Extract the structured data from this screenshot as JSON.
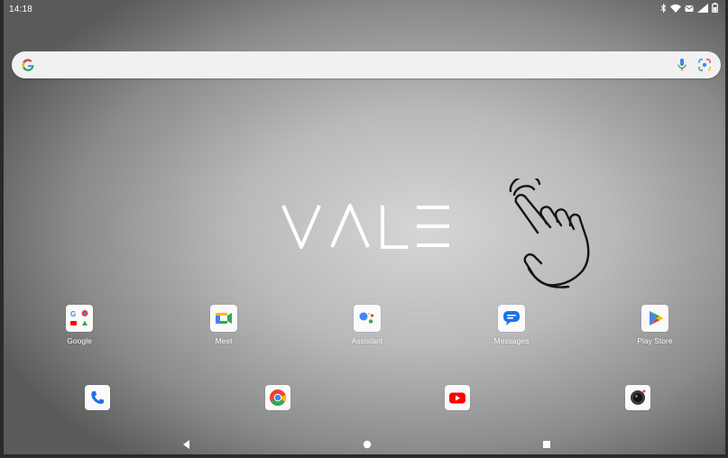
{
  "status_bar": {
    "time": "14:18",
    "icons": [
      "bluetooth-icon",
      "wifi-icon",
      "notification-icon",
      "signal-icon",
      "battery-icon"
    ]
  },
  "search_bar": {
    "icons": [
      "google-g-icon",
      "microphone-icon",
      "google-lens-icon"
    ]
  },
  "wallpaper": {
    "logo_text": "VALE",
    "illustration": "pointing-hand-icon"
  },
  "apps": [
    {
      "label": "Google",
      "icon": "google-folder-icon"
    },
    {
      "label": "Meet",
      "icon": "meet-icon"
    },
    {
      "label": "Assistant",
      "icon": "assistant-icon"
    },
    {
      "label": "Messages",
      "icon": "messages-icon"
    },
    {
      "label": "Play Store",
      "icon": "play-store-icon"
    }
  ],
  "dock": [
    {
      "icon": "phone-icon"
    },
    {
      "icon": "chrome-icon"
    },
    {
      "icon": "youtube-icon"
    },
    {
      "icon": "camera-icon"
    }
  ],
  "nav_bar": {
    "icons": [
      "back-icon",
      "home-icon",
      "recents-icon"
    ]
  },
  "colors": {
    "google_blue": "#4285F4",
    "google_red": "#EA4335",
    "google_yellow": "#FBBC05",
    "google_green": "#34A853",
    "youtube_red": "#FF0000"
  }
}
